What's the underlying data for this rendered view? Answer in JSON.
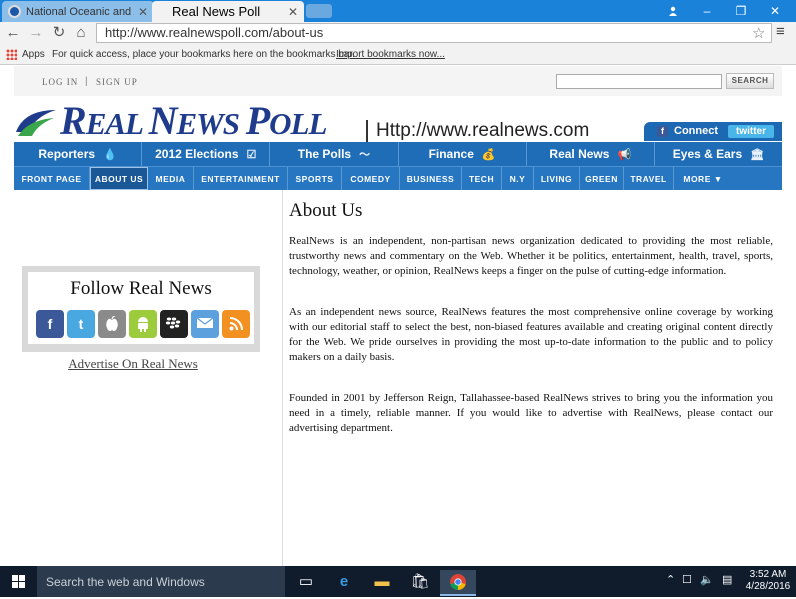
{
  "browser": {
    "tabs": [
      {
        "label": "National Oceanic and Atm",
        "active": false
      },
      {
        "label": "Real News Poll",
        "active": true
      }
    ],
    "url": "http://www.realnewspoll.com/about-us",
    "bookmarks": {
      "apps_label": "Apps",
      "hint": "For quick access, place your bookmarks here on the bookmarks bar.",
      "import_link": "Import bookmarks now..."
    },
    "window_controls": {
      "user_icon": "user-icon",
      "minimize": "–",
      "maximize": "❐",
      "close": "✕"
    }
  },
  "site": {
    "auth": {
      "login": "LOG IN",
      "separator": "|",
      "signup": "SIGN UP"
    },
    "search_button": "SEARCH",
    "logo": {
      "part1": "R",
      "part2": "EAL ",
      "part3": "N",
      "part4": "EWS ",
      "part5": "P",
      "part6": "OLL"
    },
    "logo_url": "Http://www.realnews.com",
    "social_bar": {
      "connect": "Connect",
      "twitter": "twitter"
    },
    "main_nav": [
      {
        "label": "Reporters",
        "icon": "💧"
      },
      {
        "label": "2012 Elections",
        "icon": "☑"
      },
      {
        "label": "The Polls",
        "icon": "〜"
      },
      {
        "label": "Finance",
        "icon": "💰"
      },
      {
        "label": "Real News",
        "icon": "📢"
      },
      {
        "label": "Eyes & Ears",
        "icon": "🏛"
      }
    ],
    "sub_nav": [
      "FRONT PAGE",
      "ABOUT US",
      "MEDIA",
      "ENTERTAINMENT",
      "SPORTS",
      "COMEDY",
      "BUSINESS",
      "TECH",
      "N.Y",
      "LIVING",
      "GREEN",
      "TRAVEL",
      "MORE ▼"
    ],
    "sub_nav_current": "ABOUT US",
    "follow": {
      "title": "Follow Real News",
      "icons": [
        {
          "name": "facebook-icon",
          "glyph": "f",
          "color": "#3b5998"
        },
        {
          "name": "twitter-icon",
          "glyph": "t",
          "color": "#4aa8e0"
        },
        {
          "name": "apple-icon",
          "glyph": "",
          "color": "#8a8a8a"
        },
        {
          "name": "android-icon",
          "glyph": "◙",
          "color": "#9ccc3c"
        },
        {
          "name": "blackberry-icon",
          "glyph": "⁘",
          "color": "#222222"
        },
        {
          "name": "email-icon",
          "glyph": "✉",
          "color": "#5ca0de"
        },
        {
          "name": "rss-icon",
          "glyph": "◔",
          "color": "#f39022"
        }
      ]
    },
    "advertise_link": "Advertise On Real News",
    "about": {
      "heading": "About Us",
      "paragraphs": [
        "RealNews is an independent, non-partisan news organization dedicated to providing the most reliable, trustworthy news and commentary on the Web. Whether it be politics, entertainment, health, travel, sports, technology, weather, or opinion, RealNews keeps a finger on the pulse of cutting-edge information.",
        "As an independent news source, RealNews features the most comprehensive online coverage by working with our editorial staff to select the best, non-biased features available and creating original content directly for the Web. We pride ourselves in providing the most up-to-date information to the public and to policy makers on a daily basis.",
        "Founded in 2001 by Jefferson Reign, Tallahassee-based RealNews strives to bring you the information you need in a timely, reliable manner. If you would like to advertise with RealNews, please contact our advertising department."
      ]
    }
  },
  "taskbar": {
    "search_placeholder": "Search the web and Windows",
    "time": "3:52 AM",
    "date": "4/28/2016"
  },
  "colors": {
    "titlebar": "#1a82d8",
    "nav_blue": "#1f6db6",
    "logo_blue": "#1f3c8c",
    "taskbar": "#101c2c"
  }
}
